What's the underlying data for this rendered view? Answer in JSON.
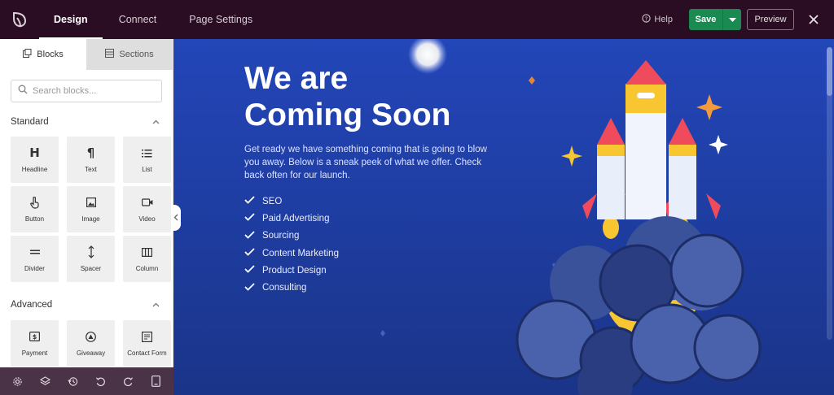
{
  "topbar": {
    "tabs": [
      {
        "label": "Design",
        "active": true
      },
      {
        "label": "Connect",
        "active": false
      },
      {
        "label": "Page Settings",
        "active": false
      }
    ],
    "help_label": "Help",
    "save_label": "Save",
    "preview_label": "Preview"
  },
  "sidebar": {
    "tabs": [
      {
        "label": "Blocks",
        "active": true
      },
      {
        "label": "Sections",
        "active": false
      }
    ],
    "search_placeholder": "Search blocks...",
    "standard_title": "Standard",
    "standard_blocks": [
      {
        "label": "Headline",
        "icon": "heading-icon"
      },
      {
        "label": "Text",
        "icon": "paragraph-icon"
      },
      {
        "label": "List",
        "icon": "list-icon"
      },
      {
        "label": "Button",
        "icon": "pointer-hand-icon"
      },
      {
        "label": "Image",
        "icon": "image-icon"
      },
      {
        "label": "Video",
        "icon": "video-camera-icon"
      },
      {
        "label": "Divider",
        "icon": "divider-icon"
      },
      {
        "label": "Spacer",
        "icon": "spacer-icon"
      },
      {
        "label": "Column",
        "icon": "columns-icon"
      }
    ],
    "advanced_title": "Advanced",
    "advanced_blocks": [
      {
        "label": "Payment",
        "icon": "payment-icon"
      },
      {
        "label": "Giveaway",
        "icon": "giveaway-icon"
      },
      {
        "label": "Contact Form",
        "icon": "contact-form-icon"
      }
    ]
  },
  "bottombar": {
    "icons": [
      "settings-gear-icon",
      "layers-icon",
      "history-icon",
      "undo-icon",
      "redo-icon",
      "device-preview-icon"
    ]
  },
  "canvas": {
    "headline_line1": "We are",
    "headline_line2": "Coming Soon",
    "description": "Get ready we have something coming that is going to blow you away. Below is a sneak peek of what we offer. Check back often for our launch.",
    "checklist": [
      "SEO",
      "Paid Advertising",
      "Sourcing",
      "Content Marketing",
      "Product Design",
      "Consulting"
    ]
  },
  "colors": {
    "topbar_bg": "#2a0d22",
    "save_green": "#1a8a52",
    "canvas_blue": "#2346b8",
    "bottombar_bg": "#4a3346"
  }
}
